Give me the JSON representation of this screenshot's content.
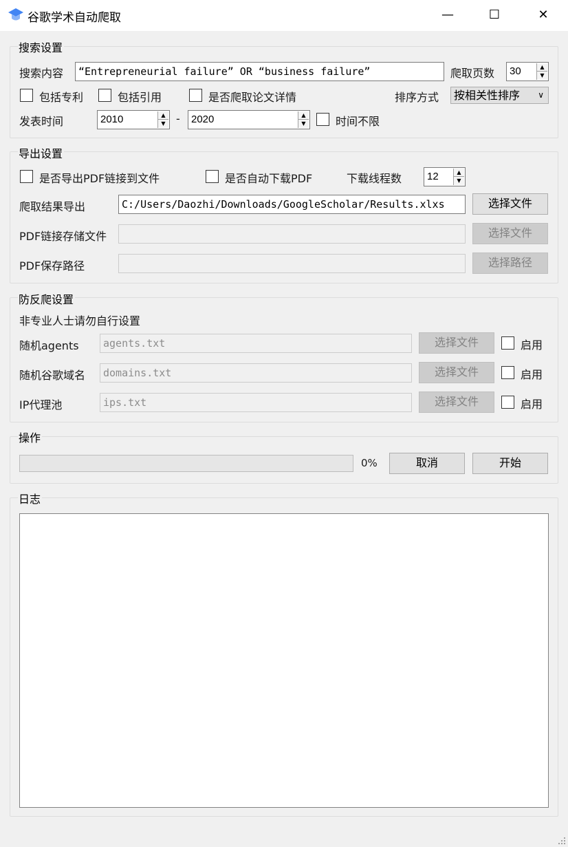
{
  "window": {
    "title": "谷歌学术自动爬取",
    "minimize_glyph": "—",
    "maximize_glyph": "☐",
    "close_glyph": "✕"
  },
  "search": {
    "group_title": "搜索设置",
    "query_label": "搜索内容",
    "query_value": "“Entrepreneurial failure” OR “business failure”",
    "pages_label": "爬取页数",
    "pages_value": "30",
    "include_patents": "包括专利",
    "include_citations": "包括引用",
    "crawl_details": "是否爬取论文详情",
    "sort_label": "排序方式",
    "sort_value": "按相关性排序",
    "date_label": "发表时间",
    "year_from": "2010",
    "dash": "-",
    "year_to": "2020",
    "no_time_limit": "时间不限"
  },
  "export": {
    "group_title": "导出设置",
    "export_pdf_links": "是否导出PDF链接到文件",
    "auto_download_pdf": "是否自动下载PDF",
    "threads_label": "下载线程数",
    "threads_value": "12",
    "results_label": "爬取结果导出",
    "results_value": "C:/Users/Daozhi/Downloads/GoogleScholar/Results.xlxs",
    "results_button": "选择文件",
    "pdf_links_label": "PDF链接存储文件",
    "pdf_links_value": "",
    "pdf_links_button": "选择文件",
    "pdf_path_label": "PDF保存路径",
    "pdf_path_value": "",
    "pdf_path_button": "选择路径"
  },
  "anti": {
    "group_title": "防反爬设置",
    "warning": "非专业人士请勿自行设置",
    "agents_label": "随机agents",
    "agents_value": "agents.txt",
    "domains_label": "随机谷歌域名",
    "domains_value": "domains.txt",
    "ip_label": "IP代理池",
    "ip_value": "ips.txt",
    "choose_file": "选择文件",
    "enable": "启用"
  },
  "ops": {
    "group_title": "操作",
    "progress_percent": 0,
    "progress_text": "0%",
    "cancel": "取消",
    "start": "开始"
  },
  "log": {
    "group_title": "日志"
  },
  "colors": {
    "accent": "#4a86e8",
    "background": "#f0f0f0"
  }
}
